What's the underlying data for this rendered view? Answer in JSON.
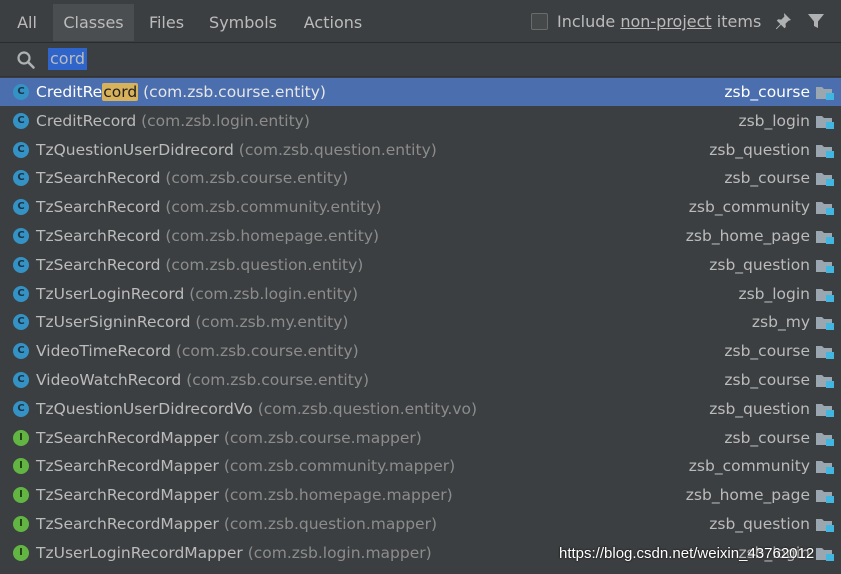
{
  "tabs": [
    {
      "label": "All",
      "active": false
    },
    {
      "label": "Classes",
      "active": true
    },
    {
      "label": "Files",
      "active": false
    },
    {
      "label": "Symbols",
      "active": false
    },
    {
      "label": "Actions",
      "active": false
    }
  ],
  "include": {
    "prefix": "Include ",
    "underlined": "non-project",
    "suffix": " items",
    "checked": false
  },
  "icons": {
    "pin": "pin-icon",
    "filter": "filter-icon",
    "search": "search-icon",
    "folder": "module-folder-icon"
  },
  "search": {
    "value": "cord"
  },
  "colors": {
    "selection": "#4b6eaf",
    "match": "#d8b15b",
    "class_icon": "#3592c4",
    "interface_icon": "#62b543"
  },
  "results": [
    {
      "kind": "C",
      "pre": "CreditRe",
      "match": "cord",
      "post": "",
      "pkg": "(com.zsb.course.entity)",
      "module": "zsb_course",
      "selected": true
    },
    {
      "kind": "C",
      "pre": "CreditRecord",
      "match": "",
      "post": "",
      "pkg": "(com.zsb.login.entity)",
      "module": "zsb_login",
      "selected": false
    },
    {
      "kind": "C",
      "pre": "TzQuestionUserDidrecord",
      "match": "",
      "post": "",
      "pkg": "(com.zsb.question.entity)",
      "module": "zsb_question",
      "selected": false
    },
    {
      "kind": "C",
      "pre": "TzSearchRecord",
      "match": "",
      "post": "",
      "pkg": "(com.zsb.course.entity)",
      "module": "zsb_course",
      "selected": false
    },
    {
      "kind": "C",
      "pre": "TzSearchRecord",
      "match": "",
      "post": "",
      "pkg": "(com.zsb.community.entity)",
      "module": "zsb_community",
      "selected": false
    },
    {
      "kind": "C",
      "pre": "TzSearchRecord",
      "match": "",
      "post": "",
      "pkg": "(com.zsb.homepage.entity)",
      "module": "zsb_home_page",
      "selected": false
    },
    {
      "kind": "C",
      "pre": "TzSearchRecord",
      "match": "",
      "post": "",
      "pkg": "(com.zsb.question.entity)",
      "module": "zsb_question",
      "selected": false
    },
    {
      "kind": "C",
      "pre": "TzUserLoginRecord",
      "match": "",
      "post": "",
      "pkg": "(com.zsb.login.entity)",
      "module": "zsb_login",
      "selected": false
    },
    {
      "kind": "C",
      "pre": "TzUserSigninRecord",
      "match": "",
      "post": "",
      "pkg": "(com.zsb.my.entity)",
      "module": "zsb_my",
      "selected": false
    },
    {
      "kind": "C",
      "pre": "VideoTimeRecord",
      "match": "",
      "post": "",
      "pkg": "(com.zsb.course.entity)",
      "module": "zsb_course",
      "selected": false
    },
    {
      "kind": "C",
      "pre": "VideoWatchRecord",
      "match": "",
      "post": "",
      "pkg": "(com.zsb.course.entity)",
      "module": "zsb_course",
      "selected": false
    },
    {
      "kind": "C",
      "pre": "TzQuestionUserDidrecordVo",
      "match": "",
      "post": "",
      "pkg": "(com.zsb.question.entity.vo)",
      "module": "zsb_question",
      "selected": false
    },
    {
      "kind": "I",
      "pre": "TzSearchRecordMapper",
      "match": "",
      "post": "",
      "pkg": "(com.zsb.course.mapper)",
      "module": "zsb_course",
      "selected": false
    },
    {
      "kind": "I",
      "pre": "TzSearchRecordMapper",
      "match": "",
      "post": "",
      "pkg": "(com.zsb.community.mapper)",
      "module": "zsb_community",
      "selected": false
    },
    {
      "kind": "I",
      "pre": "TzSearchRecordMapper",
      "match": "",
      "post": "",
      "pkg": "(com.zsb.homepage.mapper)",
      "module": "zsb_home_page",
      "selected": false
    },
    {
      "kind": "I",
      "pre": "TzSearchRecordMapper",
      "match": "",
      "post": "",
      "pkg": "(com.zsb.question.mapper)",
      "module": "zsb_question",
      "selected": false
    },
    {
      "kind": "I",
      "pre": "TzUserLoginRecordMapper",
      "match": "",
      "post": "",
      "pkg": "(com.zsb.login.mapper)",
      "module": "zsb_login",
      "selected": false
    }
  ],
  "watermark": "https://blog.csdn.net/weixin_43762012"
}
